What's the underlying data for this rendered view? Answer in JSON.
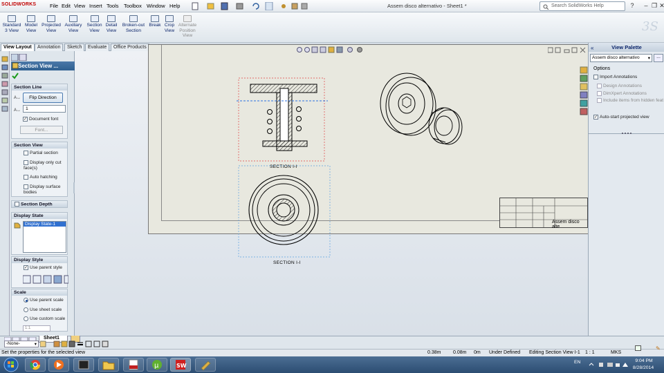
{
  "app": {
    "logo": "SOLIDWORKS",
    "doc_title": "Assem disco alternativo - Sheet1 *"
  },
  "menu": [
    "File",
    "Edit",
    "View",
    "Insert",
    "Tools",
    "Toolbox",
    "Window",
    "Help"
  ],
  "search": {
    "placeholder": "Search SolidWorks Help"
  },
  "toolbar": [
    {
      "label": "Standard 3 View",
      "enabled": true
    },
    {
      "label": "Model View",
      "enabled": true
    },
    {
      "label": "Projected View",
      "enabled": true
    },
    {
      "label": "Auxiliary View",
      "enabled": true
    },
    {
      "label": "Section View",
      "enabled": true
    },
    {
      "label": "Detail View",
      "enabled": true
    },
    {
      "label": "Broken-out Section",
      "enabled": true
    },
    {
      "label": "Break",
      "enabled": true
    },
    {
      "label": "Crop View",
      "enabled": true
    },
    {
      "label": "Alternate Position View",
      "enabled": false
    }
  ],
  "tabs": [
    {
      "label": "View Layout",
      "active": true
    },
    {
      "label": "Annotation"
    },
    {
      "label": "Sketch"
    },
    {
      "label": "Evaluate"
    },
    {
      "label": "Office Products"
    }
  ],
  "pm": {
    "title": "Section View ...",
    "section_line": {
      "header": "Section Line",
      "flip": "Flip Direction",
      "name_value": "1",
      "document_font": "Document font",
      "font_btn": "Font..."
    },
    "section_view": {
      "header": "Section View",
      "options": [
        "Partial section",
        "Display only cut face(s)",
        "Auto hatching",
        "Display surface bodies"
      ]
    },
    "section_depth": "Section Depth",
    "display_state": {
      "header": "Display State",
      "item": "Display State-1"
    },
    "display_style": {
      "header": "Display Style",
      "use_parent": "Use parent style"
    },
    "scale": {
      "header": "Scale",
      "options": [
        "Use parent scale",
        "Use sheet scale",
        "Use custom scale"
      ],
      "value": "1:1"
    }
  },
  "drawing": {
    "label_top": "SECTION I-I",
    "label_bottom": "SECTION I-I",
    "title_block_text": "Assem disco alte"
  },
  "palette": {
    "title": "View Palette",
    "select": "Assem disco alternativo",
    "options_label": "Options",
    "import": "Import Annotations",
    "sub": [
      "Design Annotations",
      "DimXpert Annotations",
      "Include items from hidden feat"
    ],
    "auto": "Auto-start projected view"
  },
  "bottom": {
    "layer": "-None-",
    "sheet_tab": "Sheet1"
  },
  "status": {
    "message": "Set the properties for the selected view",
    "x": "0.38m",
    "y": "0.08m",
    "z": "0m",
    "state": "Under Defined",
    "editing": "Editing Section View I-1",
    "scale": "1 : 1",
    "units": "MKS"
  },
  "taskbar": {
    "lang": "EN",
    "time": "9:04 PM",
    "date": "8/28/2014"
  },
  "colors": {
    "accent": "#2f5f90",
    "sheet": "#e8e8df",
    "canvas": "#dde3ea",
    "taskbar": "#2c4d72"
  }
}
